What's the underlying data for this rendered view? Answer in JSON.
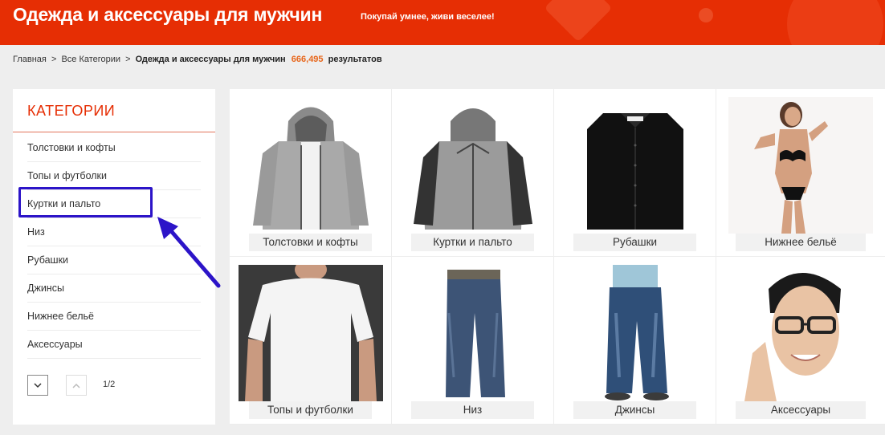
{
  "banner": {
    "title": "Одежда и аксессуары для мужчин",
    "subtitle": "Покупай умнее, живи веселее!"
  },
  "breadcrumb": {
    "home": "Главная",
    "separator": ">",
    "all_categories": "Все Категории",
    "current": "Одежда и аксессуары для мужчин",
    "count": "666,495",
    "count_label": "результатов"
  },
  "sidebar": {
    "title": "КАТЕГОРИИ",
    "items": [
      {
        "label": "Толстовки и кофты"
      },
      {
        "label": "Топы и футболки"
      },
      {
        "label": "Куртки и пальто"
      },
      {
        "label": "Низ"
      },
      {
        "label": "Рубашки"
      },
      {
        "label": "Джинсы"
      },
      {
        "label": "Нижнее бельё"
      },
      {
        "label": "Аксессуары"
      }
    ],
    "pager": {
      "down_icon": "chevron-down-icon",
      "up_icon": "chevron-up-icon",
      "info": "1/2"
    }
  },
  "annotation": {
    "color": "#2c14c8"
  },
  "grid": [
    {
      "label": "Толстовки и кофты",
      "image": "grey-hoodie-image"
    },
    {
      "label": "Куртки и пальто",
      "image": "grey-jacket-image"
    },
    {
      "label": "Рубашки",
      "image": "black-shirt-image"
    },
    {
      "label": "Нижнее бельё",
      "image": "swimwear-model-image"
    },
    {
      "label": "Топы и футболки",
      "image": "white-tshirt-image"
    },
    {
      "label": "Низ",
      "image": "jeans-pants-image"
    },
    {
      "label": "Джинсы",
      "image": "jeans-model-image"
    },
    {
      "label": "Аксессуары",
      "image": "glasses-man-image"
    }
  ],
  "colors": {
    "brand": "#e62e04",
    "count": "#e7661b",
    "background": "#eeeeee"
  }
}
